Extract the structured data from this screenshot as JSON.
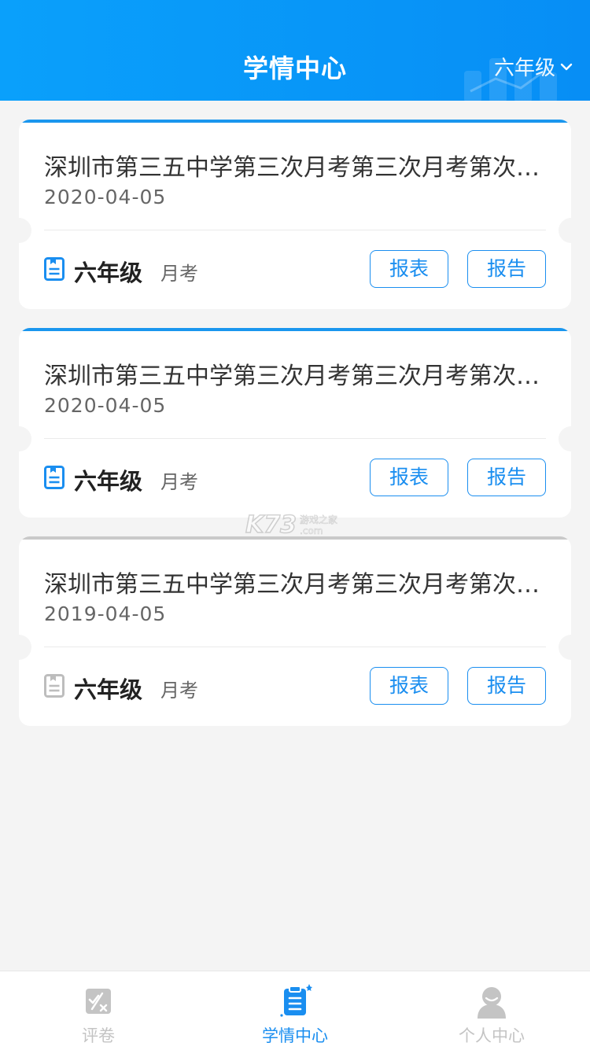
{
  "header": {
    "title": "学情中心",
    "grade_selector": "六年级"
  },
  "exams": [
    {
      "title": "深圳市第三五中学第三次月考第三次月考第次月考",
      "date": "2020-04-05",
      "grade": "六年级",
      "type": "月考",
      "table_label": "报表",
      "report_label": "报告",
      "status": "current"
    },
    {
      "title": "深圳市第三五中学第三次月考第三次月考第次月考",
      "date": "2020-04-05",
      "grade": "六年级",
      "type": "月考",
      "table_label": "报表",
      "report_label": "报告",
      "status": "current"
    },
    {
      "title": "深圳市第三五中学第三次月考第三次月考第次月考",
      "date": "2019-04-05",
      "grade": "六年级",
      "type": "月考",
      "table_label": "报表",
      "report_label": "报告",
      "status": "past"
    }
  ],
  "watermark": {
    "logo": "K73",
    "sub1": "游戏之家",
    "sub2": ".com"
  },
  "tabbar": {
    "items": [
      {
        "label": "评卷",
        "icon": "grading-icon",
        "active": false
      },
      {
        "label": "学情中心",
        "icon": "clipboard-icon",
        "active": true
      },
      {
        "label": "个人中心",
        "icon": "user-icon",
        "active": false
      }
    ]
  },
  "colors": {
    "primary": "#1a8ef0",
    "header_gradient_start": "#0aa0fb",
    "inactive": "#c4c4c4",
    "past_bar": "#c9c9c9"
  }
}
